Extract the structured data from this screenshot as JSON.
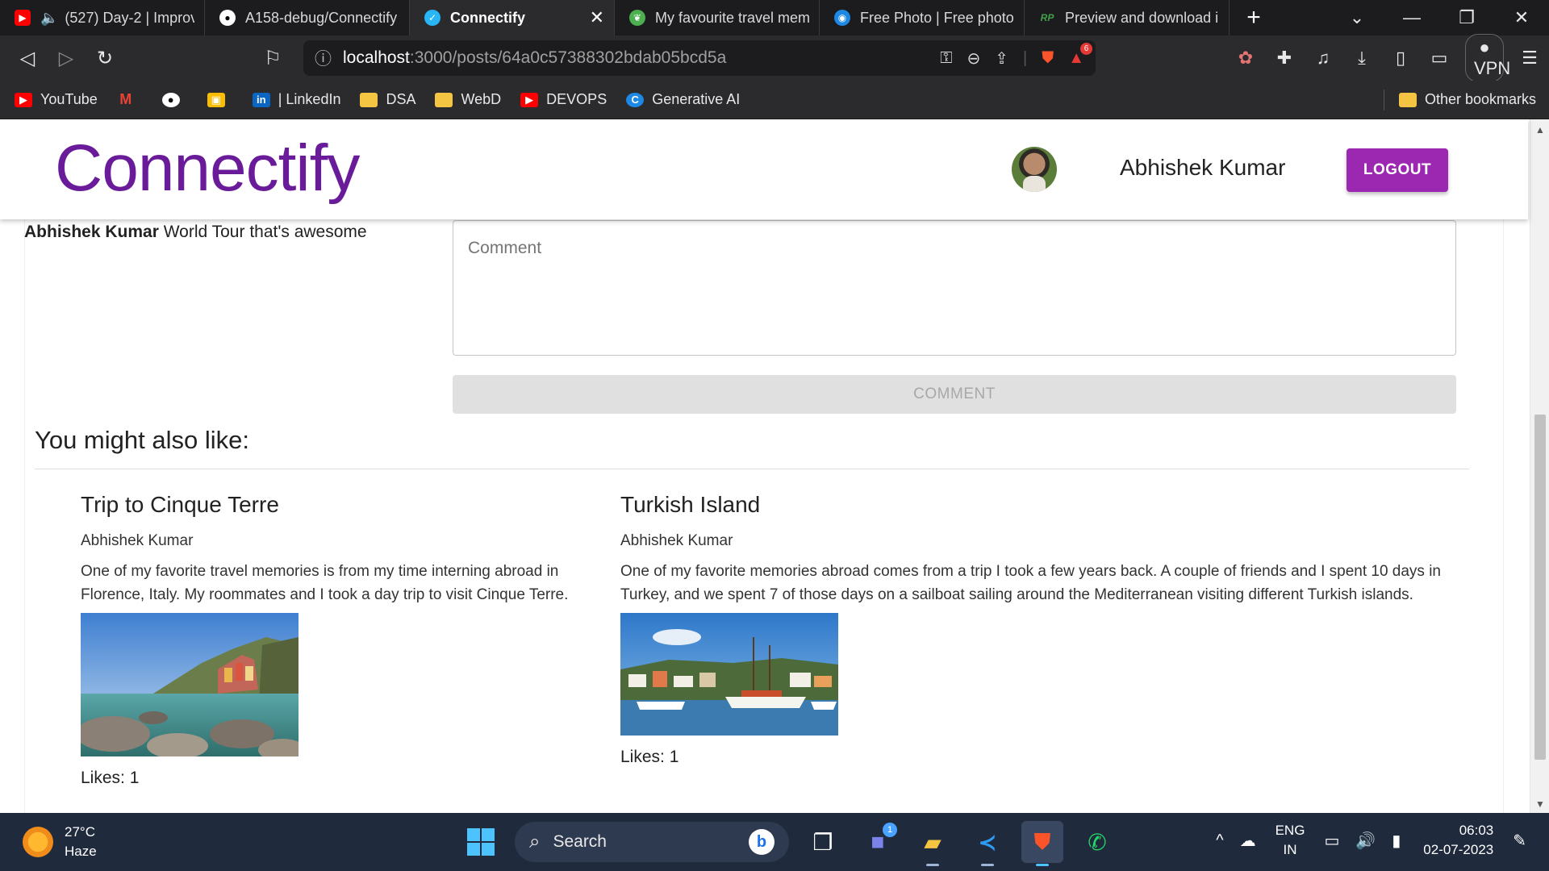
{
  "browser": {
    "tabs": [
      {
        "label": "(527) Day-2 | Improv",
        "icon": "youtube-icon",
        "color": "#ff0000"
      },
      {
        "label": "A158-debug/Connectify",
        "icon": "github-icon",
        "color": "#ffffff"
      },
      {
        "label": "Connectify",
        "icon": "app-icon",
        "color": "#29b6f6",
        "active": true
      },
      {
        "label": "My favourite travel mem",
        "icon": "leaf-icon",
        "color": "#4caf50"
      },
      {
        "label": "Free Photo | Free photo",
        "icon": "photo-icon",
        "color": "#1e88e5"
      },
      {
        "label": "Preview and download in",
        "icon": "rp-icon",
        "color": "#43a047"
      }
    ],
    "url_host": "localhost",
    "url_path": ":3000/posts/64a0c57388302bdab05bcd5a",
    "vpn_label": "VPN",
    "shield_badge": "6",
    "bookmarks": [
      {
        "label": "YouTube",
        "color": "#ff0000"
      },
      {
        "label": "",
        "color": "#ea4335",
        "icon": "gmail-icon"
      },
      {
        "label": "",
        "color": "#ffffff",
        "icon": "github-icon"
      },
      {
        "label": "",
        "color": "#fbbc04",
        "icon": "classroom-icon"
      },
      {
        "label": "| LinkedIn",
        "color": "#0a66c2"
      },
      {
        "label": "DSA",
        "color": "#f4c542"
      },
      {
        "label": "WebD",
        "color": "#f4c542"
      },
      {
        "label": "DEVOPS",
        "color": "#ff0000"
      },
      {
        "label": "Generative AI",
        "color": "#1e88e5"
      }
    ],
    "other_bookmarks": "Other bookmarks"
  },
  "header": {
    "brand": "Connectify",
    "brand_color": "#6a1b9a",
    "user_name": "Abhishek Kumar",
    "logout_label": "LOGOUT",
    "logout_color": "#9c27b0"
  },
  "comment": {
    "author": "Abhishek Kumar",
    "text": "World Tour that's awesome",
    "placeholder": "Comment",
    "button_label": "COMMENT"
  },
  "recommended": {
    "heading": "You might also like:",
    "posts": [
      {
        "title": "Trip to Cinque Terre",
        "author": "Abhishek Kumar",
        "message": "One of my favorite travel memories is from my time interning abroad in Florence, Italy. My roommates and I took a day trip to visit Cinque Terre.",
        "likes": "Likes: 1"
      },
      {
        "title": "Turkish Island",
        "author": "Abhishek Kumar",
        "message": "One of my favorite memories abroad comes from a trip I took a few years back. A couple of friends and I spent 10 days in Turkey, and we spent 7 of those days on a sailboat sailing around the Mediterranean visiting different Turkish islands.",
        "likes": "Likes: 1"
      }
    ]
  },
  "taskbar": {
    "temperature": "27°C",
    "weather": "Haze",
    "search_label": "Search",
    "chat_badge": "1",
    "lang_top": "ENG",
    "lang_bottom": "IN",
    "time": "06:03",
    "date": "02-07-2023"
  }
}
